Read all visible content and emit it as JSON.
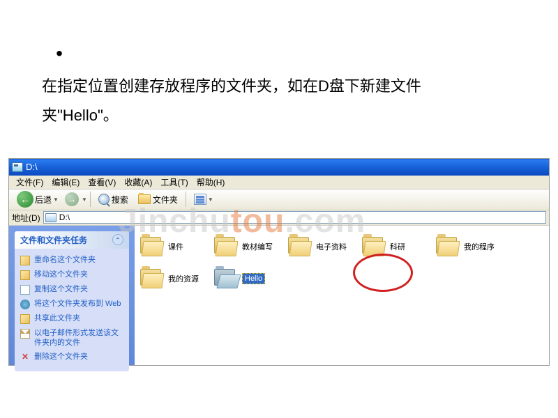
{
  "slide": {
    "bullet": "•",
    "text": "在指定位置创建存放程序的文件夹，如在D盘下新建文件夹\"Hello\"。"
  },
  "watermark": {
    "part1": "Jinchu",
    "part2": "tou",
    "part3": ".com"
  },
  "window": {
    "title": "D:\\",
    "menu": {
      "file": "文件",
      "file_u": "(F)",
      "edit": "编辑",
      "edit_u": "(E)",
      "view": "查看",
      "view_u": "(V)",
      "fav": "收藏",
      "fav_u": "(A)",
      "tools": "工具",
      "tools_u": "(T)",
      "help": "帮助",
      "help_u": "(H)"
    },
    "toolbar": {
      "back": "后退",
      "search": "搜索",
      "folders": "文件夹"
    },
    "address": {
      "label": "地址",
      "label_u": "(D)",
      "value": "D:\\"
    },
    "tasks": {
      "header": "文件和文件夹任务",
      "items": [
        "重命名这个文件夹",
        "移动这个文件夹",
        "复制这个文件夹",
        "将这个文件夹发布到 Web",
        "共享此文件夹",
        "以电子邮件形式发送该文件夹内的文件",
        "删除这个文件夹"
      ]
    },
    "folders": [
      {
        "name": "课件"
      },
      {
        "name": "教材编写"
      },
      {
        "name": "电子资料"
      },
      {
        "name": "科研"
      },
      {
        "name": "我的程序"
      },
      {
        "name": "我的资源"
      },
      {
        "name": "Hello",
        "selected": true,
        "open": true
      }
    ]
  }
}
